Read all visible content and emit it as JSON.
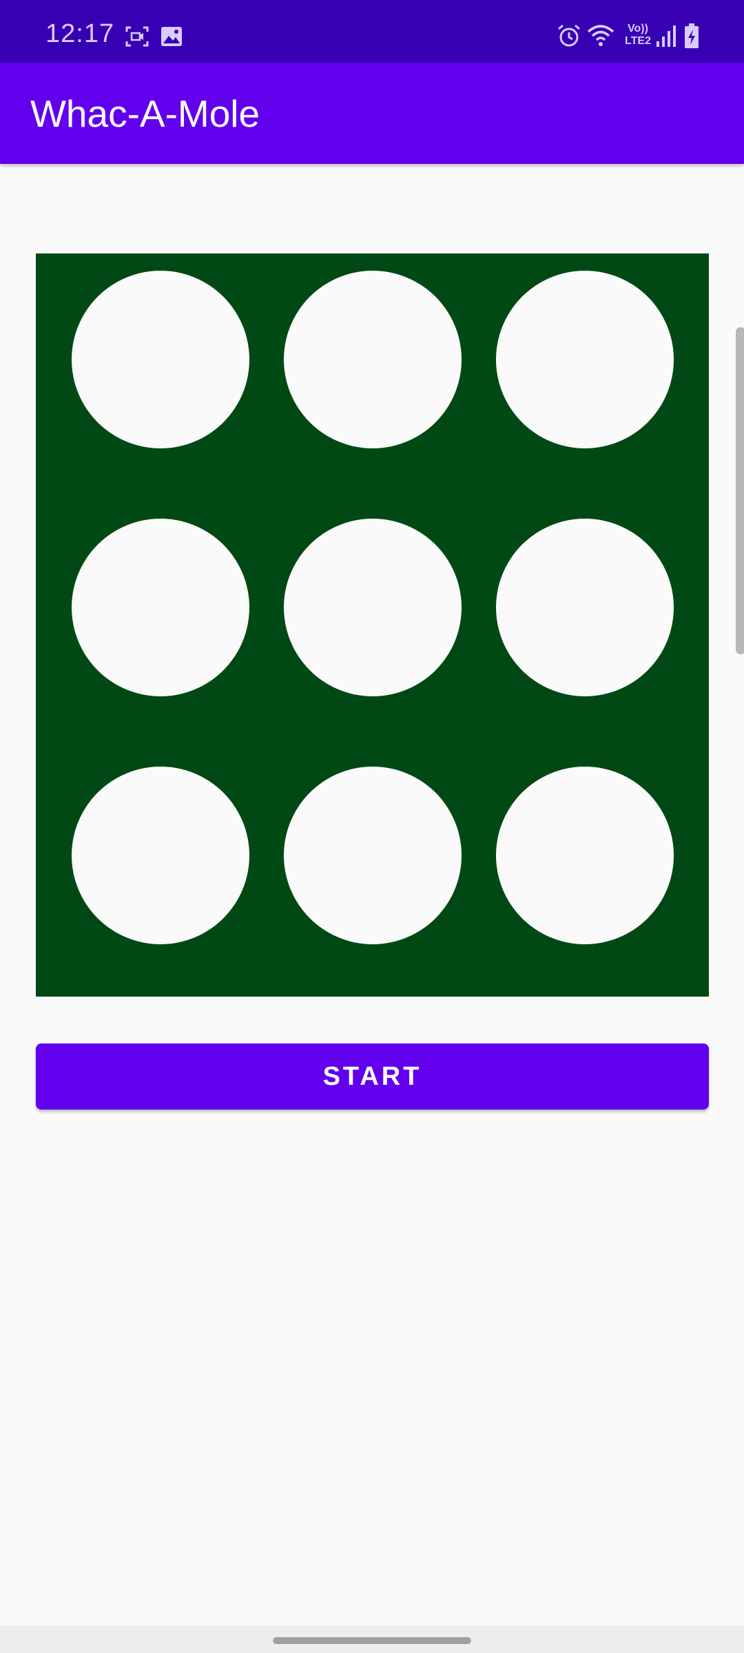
{
  "status_bar": {
    "time": "12:17",
    "icons": [
      "screen-record-icon",
      "gallery-icon",
      "alarm-icon",
      "wifi-icon",
      "volte-lte-icon",
      "signal-icon",
      "battery-charging-icon"
    ],
    "network_label": "Vo)) LTE2"
  },
  "app_bar": {
    "title": "Whac-A-Mole",
    "color": "#6200ee"
  },
  "board": {
    "background": "#004914",
    "rows": 3,
    "columns": 3,
    "holes": [
      {
        "row": 1,
        "col": 1
      },
      {
        "row": 1,
        "col": 2
      },
      {
        "row": 1,
        "col": 3
      },
      {
        "row": 2,
        "col": 1
      },
      {
        "row": 2,
        "col": 2
      },
      {
        "row": 2,
        "col": 3
      },
      {
        "row": 3,
        "col": 1
      },
      {
        "row": 3,
        "col": 2
      },
      {
        "row": 3,
        "col": 3
      }
    ]
  },
  "start_button": {
    "label": "START",
    "color": "#6200ee"
  }
}
